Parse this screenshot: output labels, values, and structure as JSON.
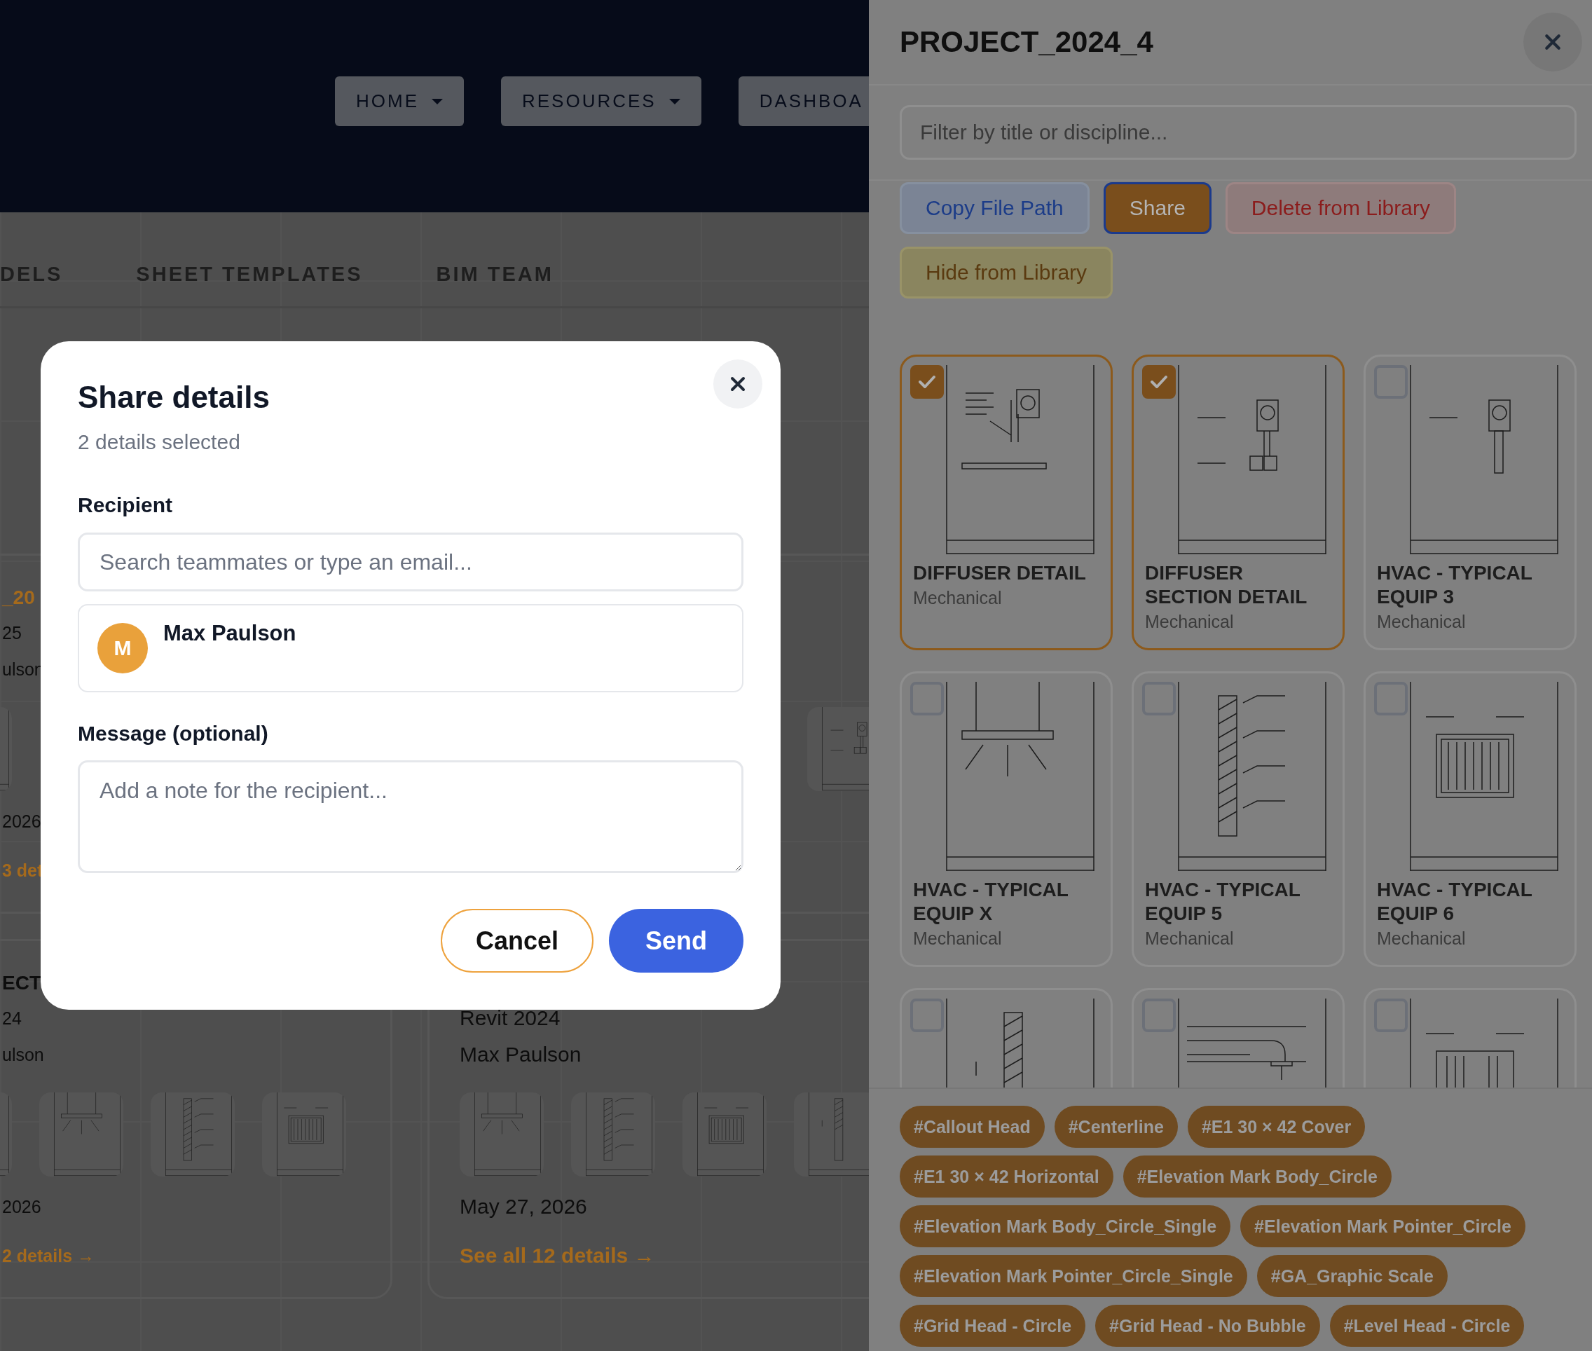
{
  "nav": {
    "items": [
      {
        "label": "HOME",
        "caret": true
      },
      {
        "label": "RESOURCES",
        "caret": true
      },
      {
        "label": "DASHBOA",
        "caret": false
      }
    ]
  },
  "tabs": [
    {
      "label": "DELS"
    },
    {
      "label": "SHEET TEMPLATES"
    },
    {
      "label": "BIM TEAM"
    }
  ],
  "project_cards": [
    {
      "title": "_20",
      "version": "25",
      "owner": "ulson",
      "thumbnails": [
        {
          "kind": "picture"
        }
      ],
      "date": "2026",
      "link": "3 det"
    },
    {
      "thumbnails": [
        {
          "kind": "picture"
        }
      ]
    },
    {
      "title": "ECT",
      "version": "24",
      "owner": "ulson",
      "thumbnails": [
        {
          "kind": "picture"
        },
        {
          "kind": "picture"
        },
        {
          "kind": "picture"
        },
        {
          "kind": "picture"
        }
      ],
      "date": "2026",
      "link": "2 details →"
    },
    {
      "version": "Revit 2024",
      "owner": "Max Paulson",
      "thumbnails": [
        {
          "kind": "picture"
        },
        {
          "kind": "picture"
        },
        {
          "kind": "picture"
        },
        {
          "kind": "picture"
        }
      ],
      "date": "May 27, 2026",
      "link": "See all 12 details →"
    }
  ],
  "share_modal": {
    "title": "Share details",
    "subtitle": "2 details selected",
    "recipient_label": "Recipient",
    "recipient_search": {
      "placeholder": "Search teammates or type an email..."
    },
    "recipients": [
      {
        "initial": "M",
        "name": "Max Paulson"
      }
    ],
    "message_label": "Message (optional)",
    "message": {
      "placeholder": "Add a note for the recipient..."
    },
    "buttons": [
      {
        "label": "Cancel",
        "kind": "secondary"
      },
      {
        "label": "Send",
        "kind": "primary"
      }
    ]
  },
  "detail_panel": {
    "title": "PROJECT_2024_4",
    "filter": {
      "placeholder": "Filter by title or discipline..."
    },
    "actions": [
      {
        "label": "Copy File Path",
        "kind": "copy",
        "focused": false
      },
      {
        "label": "Share",
        "kind": "share",
        "focused": true
      },
      {
        "label": "Delete from Library",
        "kind": "delete",
        "focused": false
      },
      {
        "label": "Hide from Library",
        "kind": "hide",
        "focused": false
      }
    ],
    "details": [
      {
        "title": "DIFFUSER DETAIL",
        "discipline": "Mechanical",
        "selected": true
      },
      {
        "title": "DIFFUSER SECTION DETAIL",
        "discipline": "Mechanical",
        "selected": true
      },
      {
        "title": "HVAC - TYPICAL EQUIP 3",
        "discipline": "Mechanical",
        "selected": false
      },
      {
        "title": "HVAC - TYPICAL EQUIP X",
        "discipline": "Mechanical",
        "selected": false
      },
      {
        "title": "HVAC - TYPICAL EQUIP 5",
        "discipline": "Mechanical",
        "selected": false
      },
      {
        "title": "HVAC - TYPICAL EQUIP 6",
        "discipline": "Mechanical",
        "selected": false
      },
      {
        "selected": false
      },
      {
        "selected": false
      },
      {
        "selected": false
      }
    ],
    "tags": [
      "#Callout Head",
      "#Centerline",
      "#E1 30 × 42 Cover",
      "#E1 30 × 42 Horizontal",
      "#Elevation Mark Body_Circle",
      "#Elevation Mark Body_Circle_Single",
      "#Elevation Mark Pointer_Circle",
      "#Elevation Mark Pointer_Circle_Single",
      "#GA_Graphic Scale",
      "#Grid Head - Circle",
      "#Grid Head - No Bubble",
      "#Level Head - Circle"
    ]
  }
}
